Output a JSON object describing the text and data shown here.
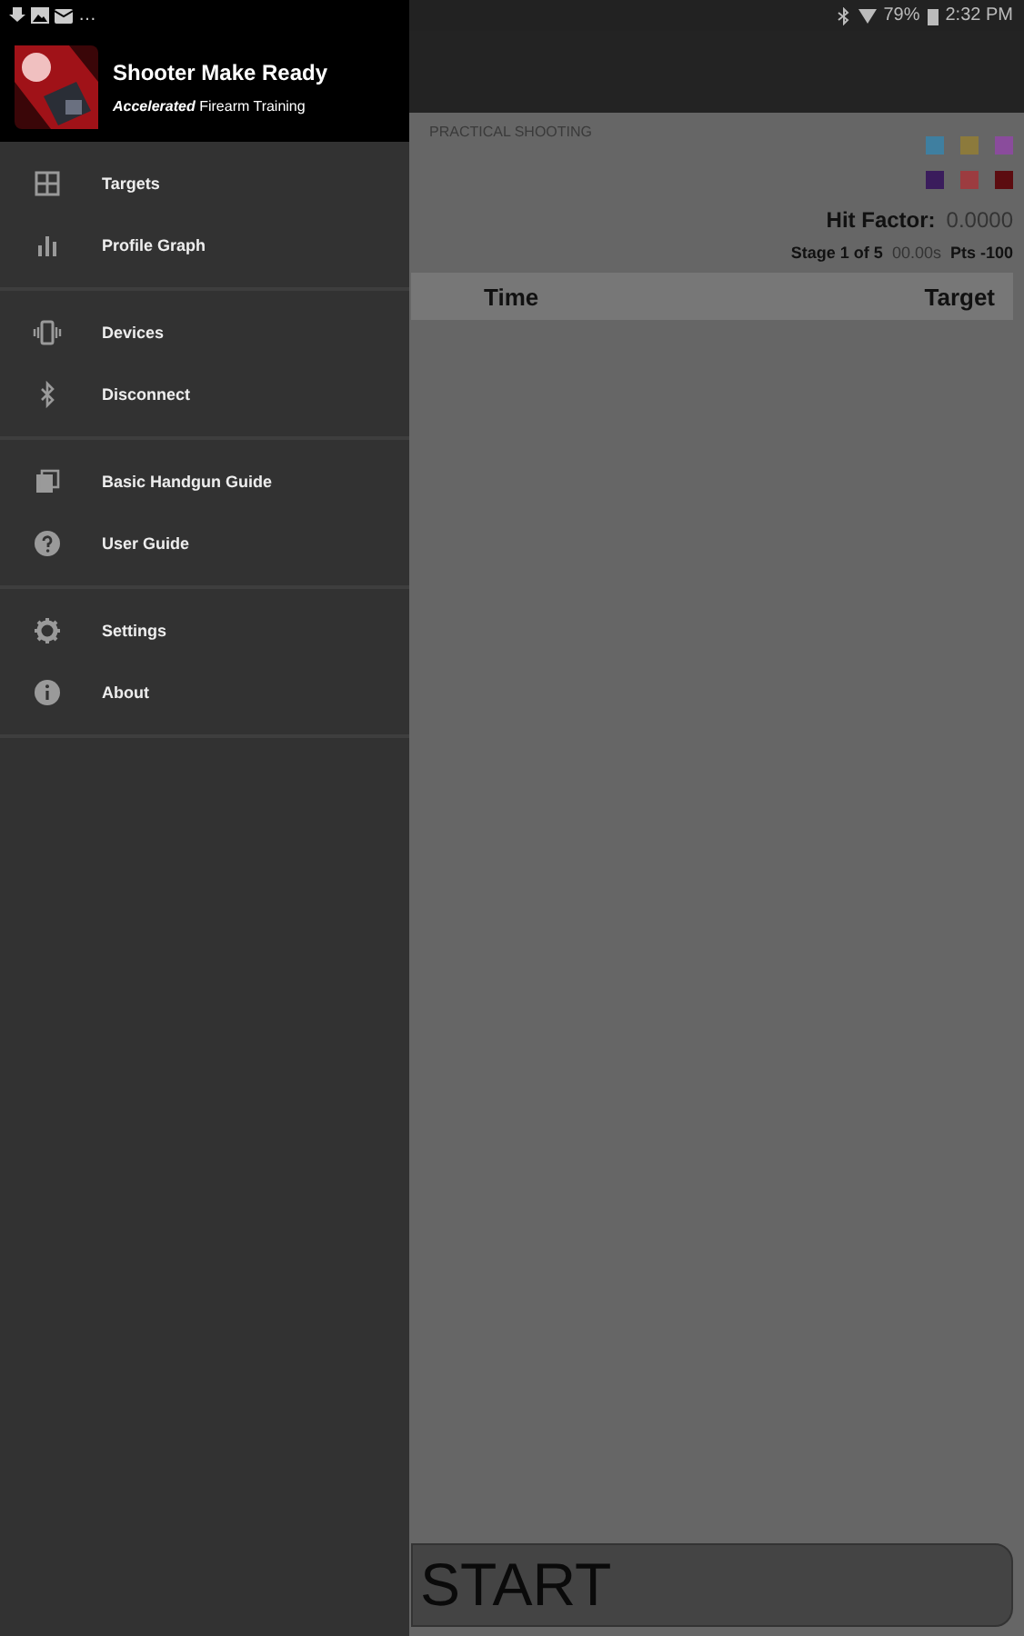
{
  "status_bar": {
    "notifications": "…",
    "battery": "79%",
    "time": "2:32 PM"
  },
  "drawer": {
    "title": "Shooter Make Ready",
    "subtitle_brand": "Accelerated",
    "subtitle": "Firearm Training",
    "groups": [
      [
        {
          "kind": "grid",
          "label": "Targets"
        },
        {
          "kind": "chart",
          "label": "Profile Graph"
        }
      ],
      [
        {
          "kind": "device",
          "label": "Devices"
        },
        {
          "kind": "bluetooth",
          "label": "Disconnect"
        }
      ],
      [
        {
          "kind": "book",
          "label": "Basic Handgun Guide"
        },
        {
          "kind": "help",
          "label": "User Guide"
        }
      ],
      [
        {
          "kind": "gear",
          "label": "Settings"
        },
        {
          "kind": "info",
          "label": "About"
        }
      ]
    ]
  },
  "card": {
    "title": "PRACTICAL SHOOTING",
    "swatches": [
      {
        "color": "#3f7fa0"
      },
      {
        "color": "#8c7a3c"
      },
      {
        "color": "#8a4c9c"
      },
      {
        "color": "#3a1c5c"
      },
      {
        "color": "#9c3c40"
      },
      {
        "color": "#5c0c10"
      }
    ],
    "hit_factor_label": "Hit Factor:",
    "hit_factor": "0.0000",
    "stage": "Stage 1 of 5",
    "stage_time": "00.00s",
    "points": "Pts -100"
  },
  "table": {
    "columns": [
      "Time",
      "Target"
    ]
  },
  "start_button": "START"
}
